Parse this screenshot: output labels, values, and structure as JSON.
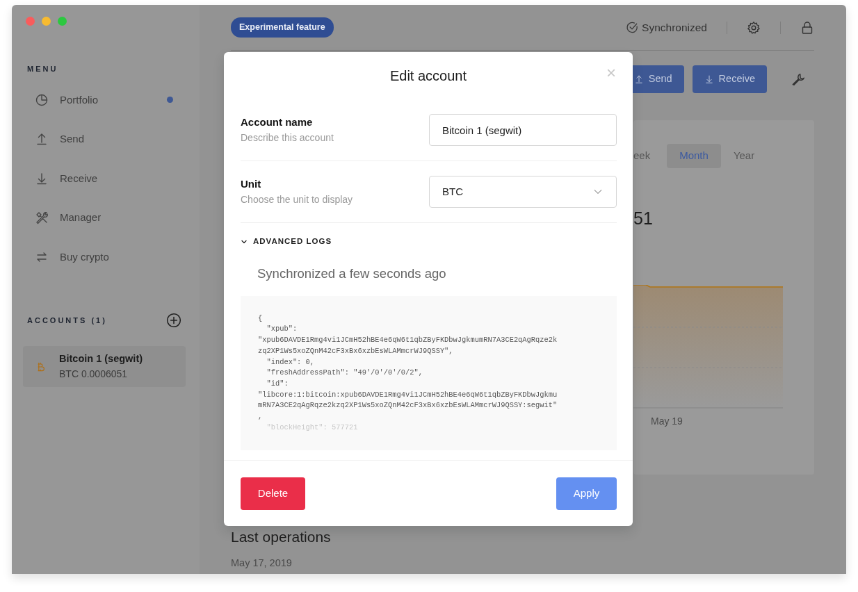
{
  "sidebar": {
    "menu_title": "MENU",
    "items": [
      {
        "label": "Portfolio",
        "kind": "portfolio",
        "notification": true
      },
      {
        "label": "Send",
        "kind": "send",
        "notification": false
      },
      {
        "label": "Receive",
        "kind": "receive",
        "notification": false
      },
      {
        "label": "Manager",
        "kind": "manager",
        "notification": false
      },
      {
        "label": "Buy crypto",
        "kind": "exchange",
        "notification": false
      }
    ],
    "accounts_title": "ACCOUNTS (1)",
    "accounts": [
      {
        "name": "Bitcoin 1 (segwit)",
        "balance": "BTC 0.0006051"
      }
    ]
  },
  "header": {
    "badge": "Experimental feature",
    "sync_status": "Synchronized"
  },
  "actions": [
    {
      "label": "Send",
      "kind": "send"
    },
    {
      "label": "Receive",
      "kind": "receive"
    }
  ],
  "chart_card": {
    "tabs": [
      {
        "label": "eek",
        "selected": false
      },
      {
        "label": "Month",
        "selected": true
      },
      {
        "label": "Year",
        "selected": false
      }
    ],
    "balance_fragment": "51",
    "x_label": "May 19"
  },
  "operations": {
    "title": "Last operations",
    "date": "May 17, 2019"
  },
  "modal": {
    "title": "Edit account",
    "close": "×",
    "fields": [
      {
        "label": "Account name",
        "description": "Describe this account",
        "kind": "text",
        "value": "Bitcoin 1 (segwit)"
      },
      {
        "label": "Unit",
        "description": "Choose the unit to display",
        "kind": "select",
        "value": "BTC"
      }
    ],
    "advanced": {
      "title": "ADVANCED LOGS",
      "expanded": true
    },
    "sync_message": "Synchronized a few seconds ago",
    "log_lines": [
      "{",
      "  \"xpub\":",
      "\"xpub6DAVDE1Rmg4vi1JCmH52hBE4e6qW6t1qbZByFKDbwJgkmumRN7A3CE2qAgRqze2k",
      "zq2XP1Ws5xoZQnM42cF3xBx6xzbEsWLAMmcrWJ9QSSY\",",
      "  \"index\": 0,",
      "  \"freshAddressPath\": \"49'/0'/0'/0/2\",",
      "  \"id\":",
      "\"libcore:1:bitcoin:xpub6DAVDE1Rmg4vi1JCmH52hBE4e6qW6t1qbZByFKDbwJgkmu",
      "mRN7A3CE2qAgRqze2kzq2XP1Ws5xoZQnM42cF3xBx6xzbEsWLAMmcrWJ9QSSY:segwit\"",
      ",",
      "  \"blockHeight\": 577721"
    ],
    "buttons": [
      {
        "label": "Delete",
        "kind": "danger"
      },
      {
        "label": "Apply",
        "kind": "primary"
      }
    ]
  }
}
